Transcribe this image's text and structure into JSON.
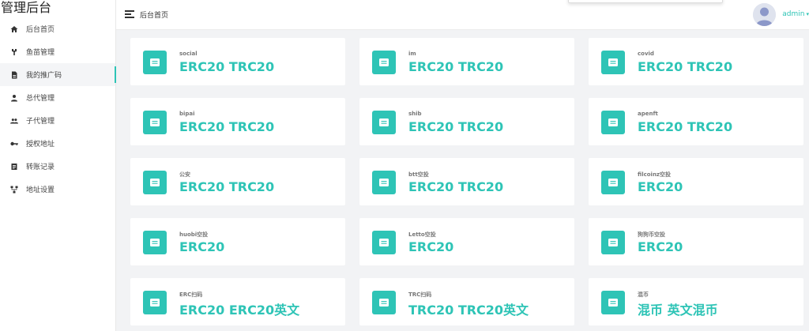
{
  "brand": "管理后台",
  "sidebar": {
    "items": [
      {
        "label": "后台首页",
        "icon": "home-icon"
      },
      {
        "label": "鱼苗管理",
        "icon": "hook-icon"
      },
      {
        "label": "我的推广码",
        "icon": "document-icon"
      },
      {
        "label": "总代管理",
        "icon": "person-icon"
      },
      {
        "label": "子代管理",
        "icon": "people-icon"
      },
      {
        "label": "授权地址",
        "icon": "key-icon"
      },
      {
        "label": "转账记录",
        "icon": "list-icon"
      },
      {
        "label": "地址设置",
        "icon": "network-icon"
      }
    ]
  },
  "header": {
    "breadcrumb": "后台首页",
    "username": "admin"
  },
  "colors": {
    "accent": "#2ec4b6"
  },
  "cards": [
    {
      "label": "social",
      "value": "ERC20 TRC20"
    },
    {
      "label": "im",
      "value": "ERC20 TRC20"
    },
    {
      "label": "covid",
      "value": "ERC20 TRC20"
    },
    {
      "label": "bipai",
      "value": "ERC20 TRC20"
    },
    {
      "label": "shib",
      "value": "ERC20 TRC20"
    },
    {
      "label": "apenft",
      "value": "ERC20 TRC20"
    },
    {
      "label": "公安",
      "value": "ERC20 TRC20"
    },
    {
      "label": "btt空投",
      "value": "ERC20 TRC20"
    },
    {
      "label": "filcoinz空投",
      "value": "ERC20"
    },
    {
      "label": "huobi空投",
      "value": "ERC20"
    },
    {
      "label": "Letto空投",
      "value": "ERC20"
    },
    {
      "label": "狗狗币空投",
      "value": "ERC20"
    },
    {
      "label": "ERC扫码",
      "value": "ERC20 ERC20英文"
    },
    {
      "label": "TRC扫码",
      "value": "TRC20 TRC20英文"
    },
    {
      "label": "混币",
      "value": "混币 英文混币"
    }
  ]
}
